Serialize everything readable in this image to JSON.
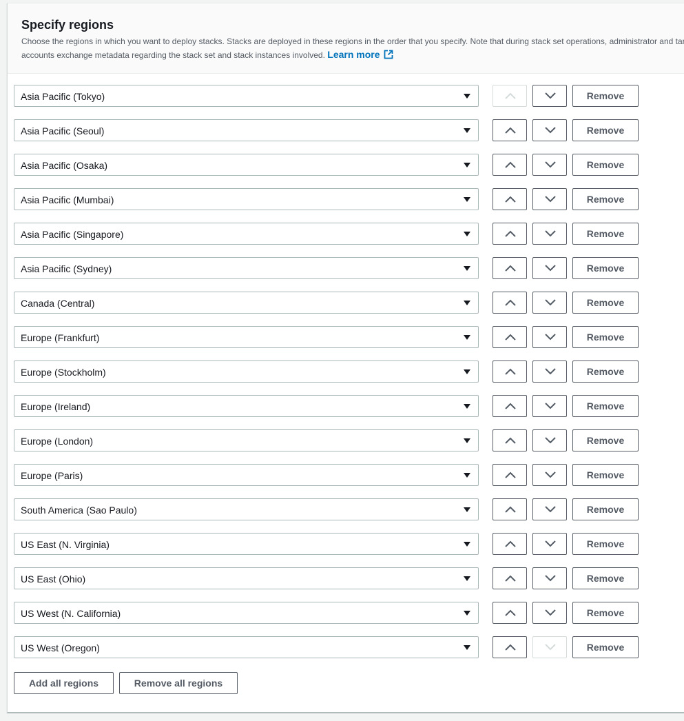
{
  "section": {
    "title": "Specify regions",
    "description": "Choose the regions in which you want to deploy stacks. Stacks are deployed in these regions in the order that you specify. Note that during stack set operations, administrator and target accounts exchange metadata regarding the stack set and stack instances involved.",
    "learn_more": "Learn more"
  },
  "remove_label": "Remove",
  "regions": [
    {
      "name": "Asia Pacific (Tokyo)",
      "up_disabled": true,
      "down_disabled": false
    },
    {
      "name": "Asia Pacific (Seoul)",
      "up_disabled": false,
      "down_disabled": false
    },
    {
      "name": "Asia Pacific (Osaka)",
      "up_disabled": false,
      "down_disabled": false
    },
    {
      "name": "Asia Pacific (Mumbai)",
      "up_disabled": false,
      "down_disabled": false
    },
    {
      "name": "Asia Pacific (Singapore)",
      "up_disabled": false,
      "down_disabled": false
    },
    {
      "name": "Asia Pacific (Sydney)",
      "up_disabled": false,
      "down_disabled": false
    },
    {
      "name": "Canada (Central)",
      "up_disabled": false,
      "down_disabled": false
    },
    {
      "name": "Europe (Frankfurt)",
      "up_disabled": false,
      "down_disabled": false
    },
    {
      "name": "Europe (Stockholm)",
      "up_disabled": false,
      "down_disabled": false
    },
    {
      "name": "Europe (Ireland)",
      "up_disabled": false,
      "down_disabled": false
    },
    {
      "name": "Europe (London)",
      "up_disabled": false,
      "down_disabled": false
    },
    {
      "name": "Europe (Paris)",
      "up_disabled": false,
      "down_disabled": false
    },
    {
      "name": "South America (Sao Paulo)",
      "up_disabled": false,
      "down_disabled": false
    },
    {
      "name": "US East (N. Virginia)",
      "up_disabled": false,
      "down_disabled": false
    },
    {
      "name": "US East (Ohio)",
      "up_disabled": false,
      "down_disabled": false
    },
    {
      "name": "US West (N. California)",
      "up_disabled": false,
      "down_disabled": false
    },
    {
      "name": "US West (Oregon)",
      "up_disabled": false,
      "down_disabled": true
    }
  ],
  "footer": {
    "add_all_label": "Add all regions",
    "remove_all_label": "Remove all regions"
  },
  "colors": {
    "link": "#0073bb",
    "border": "#aab7b8",
    "button_border": "#545b64",
    "disabled_border": "#d5dbdb"
  },
  "icons": {
    "external_link": "external-link-icon",
    "caret": "caret-down-icon",
    "up": "chevron-up-icon",
    "down": "chevron-down-icon"
  }
}
